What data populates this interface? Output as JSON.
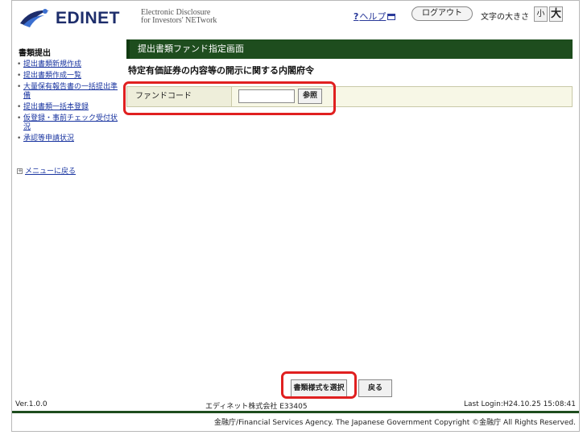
{
  "header": {
    "logo_text": "EDINET",
    "logo_sub_line1": "Electronic Disclosure",
    "logo_sub_line2": "for Investors' NETwork",
    "help_q": "?",
    "help_label": "ヘルプ",
    "logout_label": "ログアウト",
    "font_size_label": "文字の大きさ",
    "font_small": "小",
    "font_large": "大"
  },
  "sidebar": {
    "title": "書類提出",
    "items": [
      {
        "label": "提出書類新規作成"
      },
      {
        "label": "提出書類作成一覧"
      },
      {
        "label": "大量保有報告書の一括提出準備"
      },
      {
        "label": "提出書類一括本登録"
      },
      {
        "label": "仮登録・事前チェック受付状況"
      },
      {
        "label": "承認等申請状況"
      }
    ],
    "back_label": "メニューに戻る"
  },
  "main": {
    "title": "提出書類ファンド指定画面",
    "subtitle": "特定有価証券の内容等の開示に関する内閣府令",
    "fund_code_label": "ファンドコード",
    "fund_code_value": "",
    "reference_label": "参照",
    "select_form_label": "書類様式を選択",
    "back_label": "戻る"
  },
  "footer": {
    "version": "Ver.1.0.0",
    "company": "エディネット株式会社 E33405",
    "last_login": "Last Login:H24.10.25 15:08:41",
    "copyright": "金融庁/Financial Services Agency. The Japanese Government Copyright ©金融庁 All Rights Reserved."
  },
  "colors": {
    "title_bar": "#1e4d1e",
    "highlight": "#e02020",
    "link": "#1a35a0",
    "logo": "#1d2d6b"
  }
}
